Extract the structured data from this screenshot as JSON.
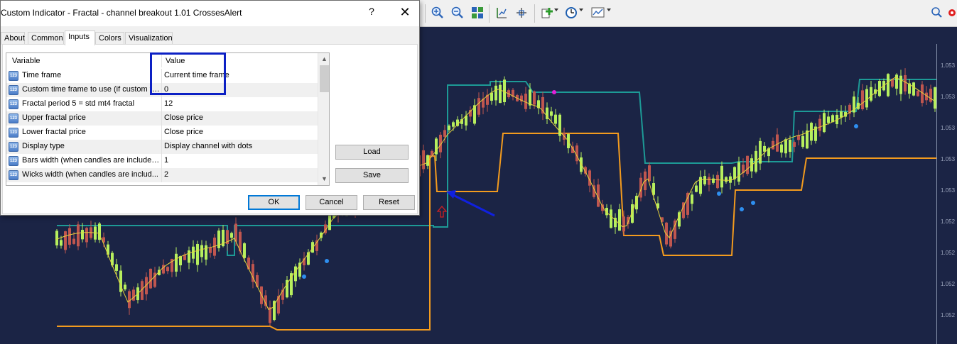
{
  "dialog": {
    "title": "Custom Indicator - Fractal - channel breakout 1.01 CrossesAlert",
    "help_label": "?",
    "close_label": "✕",
    "tabs": [
      "About",
      "Common",
      "Inputs",
      "Colors",
      "Visualization"
    ],
    "active_tab": "Inputs",
    "grid": {
      "headers": {
        "variable": "Variable",
        "value": "Value"
      },
      "type_icon_label": "123",
      "rows": [
        {
          "name": "Time frame",
          "value": "Current time frame"
        },
        {
          "name": "Custom time frame to use (if custom tim...",
          "value": "0"
        },
        {
          "name": "Fractal period 5 = std mt4 fractal",
          "value": "12"
        },
        {
          "name": "Upper fractal price",
          "value": "Close price"
        },
        {
          "name": "Lower fractal price",
          "value": "Close price"
        },
        {
          "name": "Display type",
          "value": "Display channel with dots"
        },
        {
          "name": "Bars width (when candles are included...",
          "value": "1"
        },
        {
          "name": "Wicks width (when candles are includ...",
          "value": "2"
        }
      ]
    },
    "buttons": {
      "load": "Load",
      "save": "Save",
      "ok": "OK",
      "cancel": "Cancel",
      "reset": "Reset"
    }
  },
  "toolbar": {
    "icons": [
      "zoom-in-icon",
      "zoom-out-icon",
      "tile-windows-icon",
      "period-separator-icon",
      "crosshair-chart-icon",
      "indicators-icon",
      "clock-periodicity-icon",
      "templates-icon",
      "search-icon",
      "settings-icon"
    ]
  },
  "chart": {
    "background": "#1b2445",
    "colors": {
      "bull": "#b7ef5e",
      "bear": "#c0564f",
      "upper_channel": "#1d9a96",
      "lower_channel": "#f39b1e",
      "ma_line": "#e6d23c",
      "dot_blue": "#2e8ff0",
      "dot_magenta": "#e020d8",
      "arrow": "#1020e0",
      "up_arrow": "#d02020"
    },
    "price_labels": [
      "1.053",
      "1.053",
      "1.053",
      "1.053",
      "1.053",
      "1.052",
      "1.052",
      "1.052",
      "1.052"
    ]
  }
}
